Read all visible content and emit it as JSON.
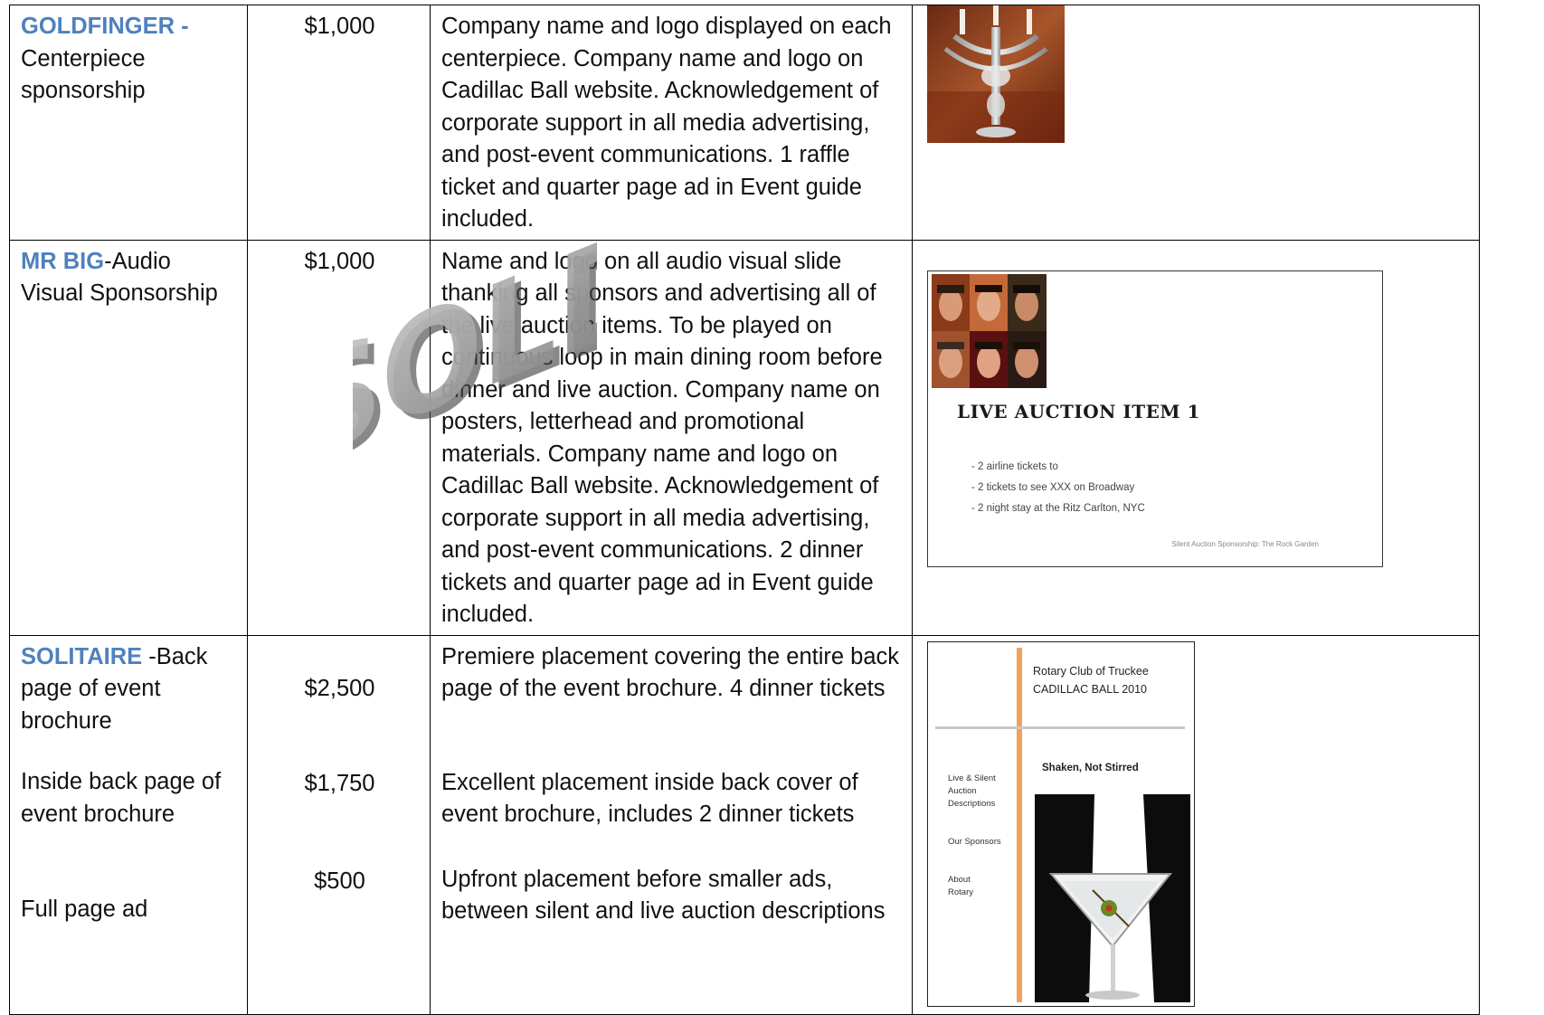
{
  "rows": [
    {
      "tier_name": "GOLDFINGER -",
      "tier_desc": "Centerpiece sponsorship",
      "price": "$1,000",
      "description": "Company name and logo displayed on each centerpiece. Company name and logo on Cadillac Ball website. Acknowledgement of corporate support in all media advertising, and post-event communications. 1 raffle ticket and quarter page ad in Event guide included.",
      "image": "candelabra-centerpiece-photo"
    },
    {
      "tier_name": "MR BIG",
      "tier_desc": "-Audio Visual Sponsorship",
      "price": "$1,000",
      "description": "Name and logo on all audio visual slide thanking all sponsors and advertising all of the live auction items. To be played on continuous loop in main dining room before dinner and live auction.  Company name on posters, letterhead and promotional materials. Company name and logo on Cadillac Ball website. Acknowledgement of corporate support in all media advertising, and post-event communications. 2 dinner tickets and quarter page ad in Event guide included.",
      "stamp": "SOLD",
      "slide": {
        "title": "LIVE AUCTION ITEM 1",
        "bullets": [
          "- 2 airline tickets to",
          "- 2 tickets to see XXX on Broadway",
          "- 2 night stay at the Ritz Carlton, NYC"
        ],
        "footer": "Silent Auction Sponsorship: The Rock Garden"
      }
    },
    {
      "tier_name": "SOLITAIRE",
      "tier_desc": " -Back page of event brochure",
      "price": "$2,500",
      "description": "Premiere placement covering the entire back page of the event brochure.  4 dinner tickets",
      "sub_items": [
        {
          "label": "Inside back page of event brochure",
          "price": "$1,750",
          "description": "Excellent placement inside back cover of event brochure, includes 2 dinner tickets"
        },
        {
          "label": "Full page ad",
          "price": "$500",
          "description": "Upfront placement before smaller ads, between silent and live auction descriptions"
        }
      ],
      "brochure": {
        "org": "Rotary Club of Truckee",
        "event": "CADILLAC BALL 2010",
        "tagline": "Shaken, Not Stirred",
        "side1": "Live & Silent Auction Descriptions",
        "side2": "Our Sponsors",
        "side3": "About Rotary"
      }
    }
  ],
  "colors": {
    "tier_name": "#4f81bd",
    "brochure_bar": "#f0a25a",
    "border": "#000000"
  }
}
